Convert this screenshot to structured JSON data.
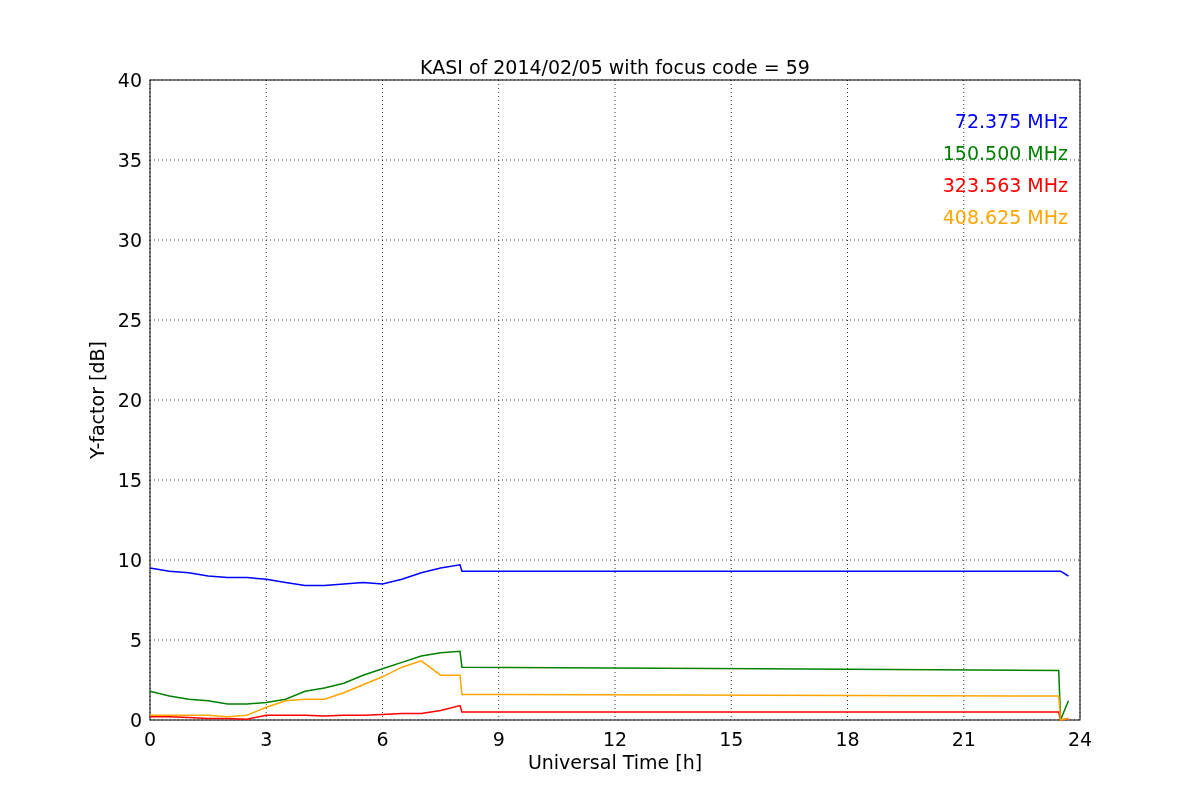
{
  "chart_data": {
    "type": "line",
    "title": "KASI of 2014/02/05 with focus code = 59",
    "xlabel": "Universal Time [h]",
    "ylabel": "Y-factor [dB]",
    "x": [
      0,
      0.5,
      1,
      1.5,
      2,
      2.5,
      3,
      3.5,
      4,
      4.5,
      5,
      5.5,
      6,
      6.5,
      7,
      7.5,
      8,
      8.05,
      23.45,
      23.5,
      23.7
    ],
    "series": [
      {
        "name": "72.375 MHz",
        "color": "#0000ff",
        "values": [
          9.5,
          9.3,
          9.2,
          9.0,
          8.9,
          8.9,
          8.8,
          8.6,
          8.4,
          8.4,
          8.5,
          8.6,
          8.5,
          8.8,
          9.2,
          9.5,
          9.7,
          9.3,
          9.3,
          9.3,
          9.0
        ]
      },
      {
        "name": "150.500 MHz",
        "color": "#008000",
        "values": [
          1.8,
          1.5,
          1.3,
          1.2,
          1.0,
          1.0,
          1.1,
          1.3,
          1.8,
          2.0,
          2.3,
          2.8,
          3.2,
          3.6,
          4.0,
          4.2,
          4.3,
          3.3,
          3.1,
          0.0,
          1.2
        ]
      },
      {
        "name": "323.563 MHz",
        "color": "#ff0000",
        "values": [
          0.2,
          0.2,
          0.15,
          0.1,
          0.1,
          0.05,
          0.3,
          0.3,
          0.3,
          0.25,
          0.3,
          0.3,
          0.35,
          0.4,
          0.4,
          0.6,
          0.9,
          0.5,
          0.5,
          0.0,
          0.1
        ]
      },
      {
        "name": "408.625 MHz",
        "color": "#ffa500",
        "values": [
          0.3,
          0.3,
          0.3,
          0.3,
          0.2,
          0.3,
          0.8,
          1.2,
          1.3,
          1.3,
          1.7,
          2.2,
          2.7,
          3.3,
          3.7,
          2.8,
          2.8,
          1.6,
          1.5,
          0.0,
          0.1
        ]
      }
    ],
    "xlim": [
      0,
      24
    ],
    "ylim": [
      0,
      40
    ],
    "xticks": [
      0,
      3,
      6,
      9,
      12,
      15,
      18,
      21,
      24
    ],
    "yticks": [
      0,
      5,
      10,
      15,
      20,
      25,
      30,
      35,
      40
    ],
    "grid": true
  }
}
